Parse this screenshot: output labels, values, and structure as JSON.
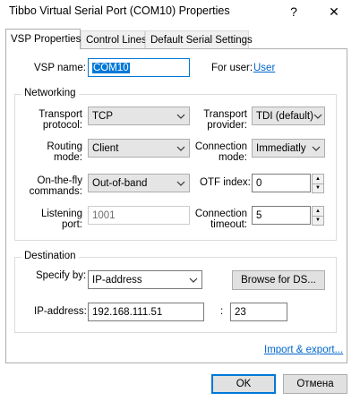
{
  "window": {
    "title": "Tibbo Virtual Serial Port (COM10) Properties",
    "help_glyph": "?",
    "close_glyph": "✕"
  },
  "tabs": [
    {
      "label": "VSP Properties",
      "active": true
    },
    {
      "label": "Control Lines",
      "active": false
    },
    {
      "label": "Default Serial Settings",
      "active": false
    }
  ],
  "vsp": {
    "name_label": "VSP name:",
    "name_value": "COM10",
    "for_user_label": "For user:",
    "for_user_link": "User"
  },
  "networking": {
    "title": "Networking",
    "transport_protocol_label": [
      "Transport",
      "protocol:"
    ],
    "transport_protocol_value": "TCP",
    "transport_provider_label": [
      "Transport",
      "provider:"
    ],
    "transport_provider_value": "TDI (default)",
    "routing_mode_label": [
      "Routing",
      "mode:"
    ],
    "routing_mode_value": "Client",
    "connection_mode_label": [
      "Connection",
      "mode:"
    ],
    "connection_mode_value": "Immediatly",
    "onthefly_label": [
      "On-the-fly",
      "commands:"
    ],
    "onthefly_value": "Out-of-band",
    "otf_index_label": "OTF index:",
    "otf_index_value": "0",
    "listening_port_label": [
      "Listening",
      "port:"
    ],
    "listening_port_value": "1001",
    "connection_timeout_label": [
      "Connection",
      "timeout:"
    ],
    "connection_timeout_value": "5"
  },
  "destination": {
    "title": "Destination",
    "specify_by_label": "Specify by:",
    "specify_by_value": "IP-address",
    "browse_label": "Browse for DS...",
    "ip_label": "IP-address:",
    "ip_value": "192.168.111.51",
    "port_separator": ":",
    "port_value": "23"
  },
  "import_export_link": "Import & export...",
  "buttons": {
    "ok": "OK",
    "cancel": "Отмена"
  },
  "colors": {
    "accent": "#0078d7",
    "link": "#0066cc"
  },
  "icons": [
    "help-icon",
    "close-icon",
    "chevron-down-icon",
    "spin-up-icon",
    "spin-down-icon"
  ]
}
